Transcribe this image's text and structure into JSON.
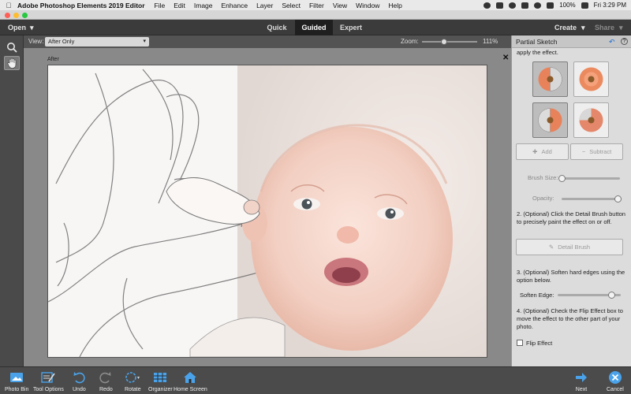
{
  "menubar": {
    "app_name": "Adobe Photoshop Elements 2019 Editor",
    "items": [
      "File",
      "Edit",
      "Image",
      "Enhance",
      "Layer",
      "Select",
      "Filter",
      "View",
      "Window",
      "Help"
    ],
    "battery": "100%",
    "time": "Fri 3:29 PM"
  },
  "modebar": {
    "open_label": "Open",
    "tabs": [
      {
        "label": "Quick",
        "active": false
      },
      {
        "label": "Guided",
        "active": true
      },
      {
        "label": "Expert",
        "active": false
      }
    ],
    "create_label": "Create",
    "share_label": "Share"
  },
  "options": {
    "view_label": "View:",
    "view_value": "After Only",
    "zoom_label": "Zoom:",
    "zoom_value": "111%",
    "zoom_level": 0.4
  },
  "canvas": {
    "label": "After",
    "close_glyph": "✕"
  },
  "panel": {
    "title": "Partial Sketch",
    "intro_text": "apply the effect.",
    "add_label": "Add",
    "subtract_label": "Subtract",
    "brush_size_label": "Brush Size:",
    "opacity_label": "Opacity:",
    "step2_text": "2. (Optional) Click the Detail Brush button to precisely paint the effect on or off.",
    "detail_brush_label": "Detail Brush",
    "step3_text": "3. (Optional) Soften hard edges using the option below.",
    "soften_edge_label": "Soften Edge:",
    "soften_edge_level": 0.85,
    "step4_text": "4. (Optional) Check the Flip Effect box to move the effect to the other part of your photo.",
    "flip_effect_label": "Flip Effect",
    "flip_effect_checked": false
  },
  "bottombar": {
    "photo_bin": "Photo Bin",
    "tool_options": "Tool Options",
    "undo": "Undo",
    "redo": "Redo",
    "rotate": "Rotate",
    "organizer": "Organizer",
    "home_screen": "Home Screen",
    "next": "Next",
    "cancel": "Cancel"
  },
  "colors": {
    "accent_blue": "#2f80d0",
    "active_tab_bg": "#1f1f1f"
  }
}
